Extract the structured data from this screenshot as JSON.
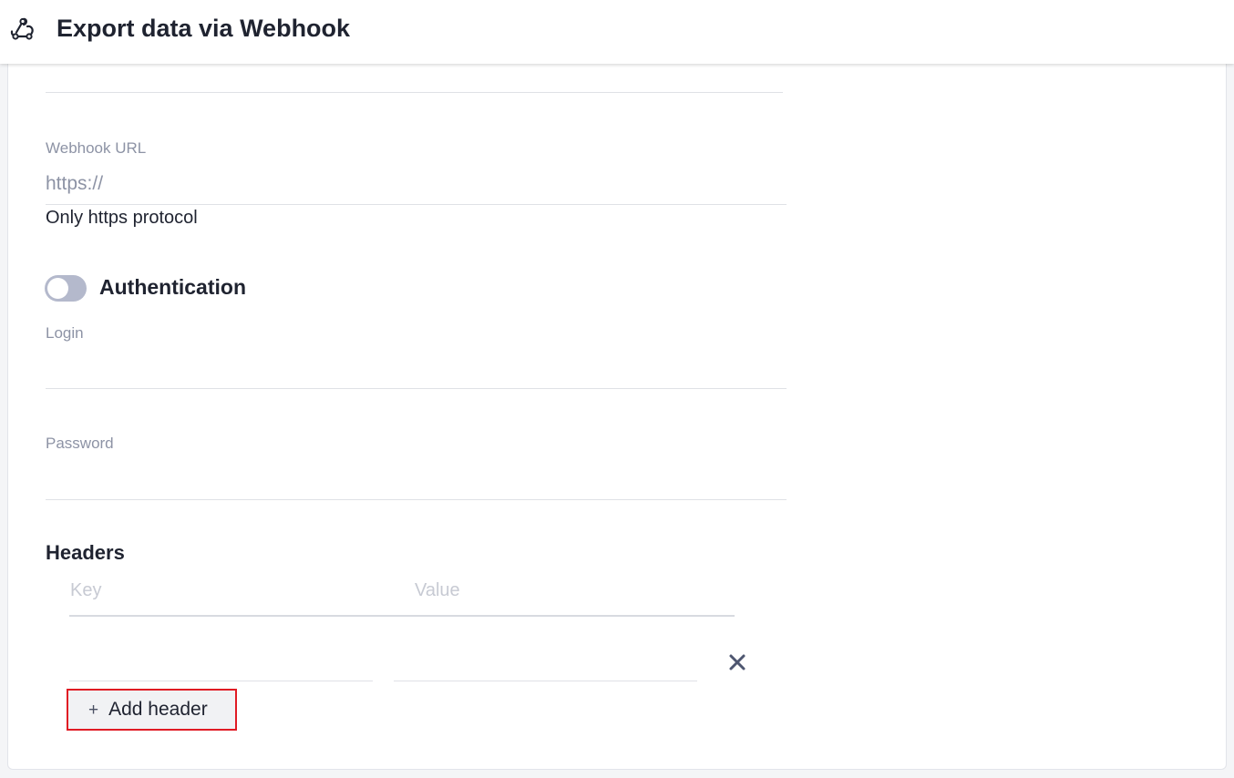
{
  "header": {
    "title": "Export data via Webhook",
    "icon": "webhook-icon"
  },
  "form": {
    "webhook_url": {
      "label": "Webhook URL",
      "placeholder": "https://",
      "value": "",
      "helper": "Only https protocol"
    },
    "authentication": {
      "label": "Authentication",
      "enabled": false
    },
    "login": {
      "label": "Login",
      "value": ""
    },
    "password": {
      "label": "Password",
      "value": ""
    },
    "headers": {
      "title": "Headers",
      "key_placeholder": "Key",
      "value_placeholder": "Value",
      "rows": [
        {
          "key": "",
          "value": ""
        }
      ],
      "add_label": "Add header",
      "add_icon": "plus-icon",
      "remove_icon": "close-icon"
    }
  },
  "colors": {
    "text": "#1f2330",
    "label": "#8d93a5",
    "toggle_off": "#b4b9cc",
    "highlight": "#e01b24"
  }
}
